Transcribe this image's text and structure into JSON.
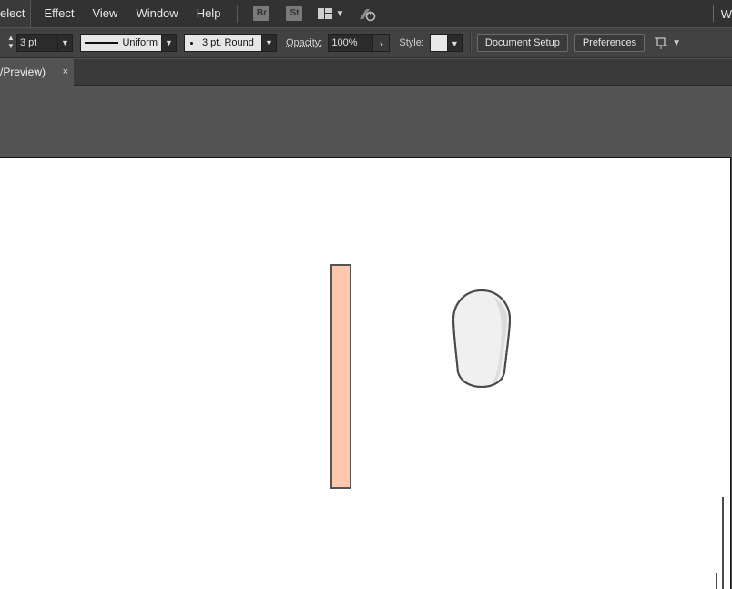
{
  "menubar": {
    "items": [
      "elect",
      "Effect",
      "View",
      "Window",
      "Help"
    ],
    "bridge_badge": "Br",
    "stock_badge": "St",
    "right_text": "W"
  },
  "controlbar": {
    "stroke_weight": "3 pt",
    "stroke_profile": "Uniform",
    "brush": "3 pt. Round",
    "opacity_label": "Opacity:",
    "opacity_value": "100%",
    "style_label": "Style:",
    "document_setup": "Document Setup",
    "preferences": "Preferences"
  },
  "tab": {
    "title": "/Preview)",
    "close": "×"
  },
  "artwork": {
    "rect_fill": "#ffc7ad",
    "rect_stroke": "#555555",
    "pebble_fill": "#f0f0f0",
    "pebble_shade": "#dcdcdc",
    "pebble_stroke": "#4a4a4a"
  }
}
